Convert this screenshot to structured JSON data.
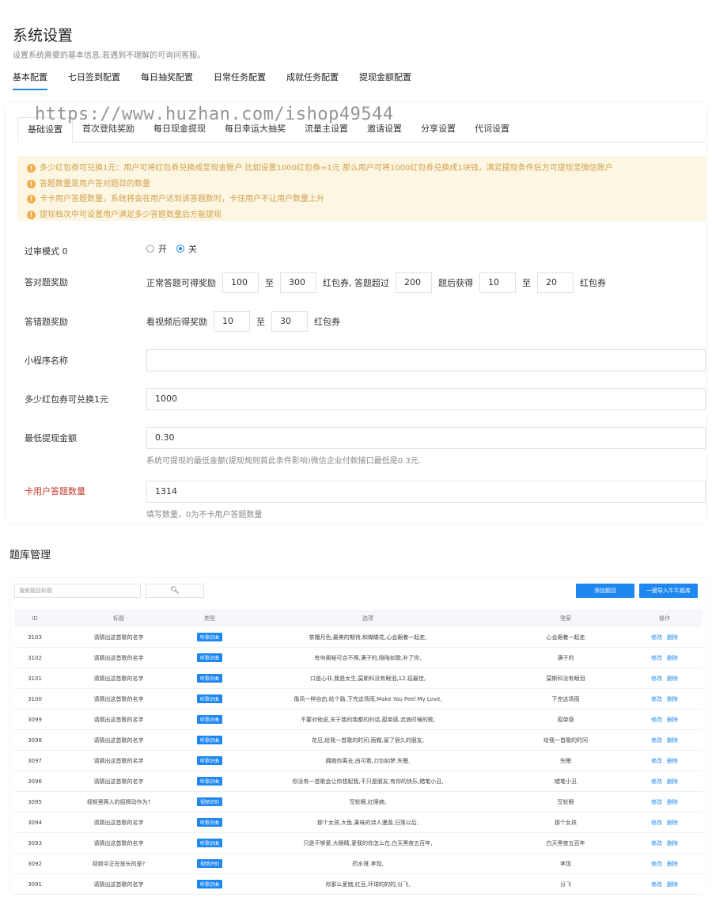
{
  "header": {
    "title": "系统设置",
    "subtitle": "设置系统需要的基本信息,若遇到不理解的可询问客服。"
  },
  "top_tabs": [
    {
      "label": "基本配置",
      "active": true
    },
    {
      "label": "七日签到配置",
      "active": false
    },
    {
      "label": "每日抽奖配置",
      "active": false
    },
    {
      "label": "日常任务配置",
      "active": false
    },
    {
      "label": "成就任务配置",
      "active": false
    },
    {
      "label": "提现金额配置",
      "active": false
    }
  ],
  "sub_tabs": [
    {
      "label": "基础设置",
      "active": true
    },
    {
      "label": "首次登陆奖励",
      "active": false
    },
    {
      "label": "每日现金提现",
      "active": false
    },
    {
      "label": "每日幸运大抽奖",
      "active": false
    },
    {
      "label": "流量主设置",
      "active": false
    },
    {
      "label": "邀请设置",
      "active": false
    },
    {
      "label": "分享设置",
      "active": false
    },
    {
      "label": "代词设置",
      "active": false
    }
  ],
  "notices": [
    "多少红包券可兑换1元：用户可将红包券兑换成至现金账户 比如设置1000红包券=1元 那么用户可将1000红包券兑换成1块钱，满足提现条件后方可提现至微信账户",
    "答题数量是用户答对题目的数量",
    "卡卡用户答题数量，系统将会在用户达到该答题数时，卡住用户不让用户数量上升",
    "提现档次中可设置用户满足多少答题数量后方能提现"
  ],
  "form": {
    "audit_mode": {
      "label": "过审模式 0",
      "on_label": "开",
      "off_label": "关",
      "selected": "off"
    },
    "correct_reward": {
      "label": "答对题奖励",
      "prefix": "正常答题可得奖励",
      "min": "100",
      "to1": "至",
      "max": "300",
      "mid": "红包券, 答题超过",
      "threshold": "200",
      "after": "题后获得",
      "min2": "10",
      "to2": "至",
      "max2": "20",
      "suffix": "红包券"
    },
    "wrong_reward": {
      "label": "答错题奖励",
      "prefix": "看视频后得奖励",
      "min": "10",
      "to": "至",
      "max": "30",
      "suffix": "红包券"
    },
    "mini_name": {
      "label": "小程序名称",
      "value": ""
    },
    "exchange_rate": {
      "label": "多少红包券可兑换1元",
      "value": "1000"
    },
    "min_withdraw": {
      "label": "最低提现金额",
      "value": "0.30",
      "hint": "系统可提现的最低金额(提现规则首此条件影响)微信企业付款接口最低是0.3元."
    },
    "stuck_count": {
      "label": "卡用户答题数量",
      "value": "1314",
      "hint": "填写数量，0为不卡用户答题数量"
    }
  },
  "question_bank": {
    "title": "题库管理",
    "search_placeholder": "搜索题目标题",
    "add_button": "添加题目",
    "import_button": "一键导入牛牛题库",
    "columns": {
      "id": "ID",
      "title": "标题",
      "type": "类型",
      "options": "选项",
      "answer": "答案",
      "actions": "操作"
    },
    "edit_label": "修改",
    "delete_label": "删除",
    "rows": [
      {
        "id": "3103",
        "title": "请猜出这首歌的名字",
        "type": "听歌识曲",
        "options": "茶棚月色,最美的期待,和蝴蝶花,心会跟着一起走,",
        "answer": "心会跟着一起走"
      },
      {
        "id": "3102",
        "title": "请猜出这首歌的名字",
        "type": "听歌识曲",
        "options": "有何奥秘可合不得,满子的,陪陪如歌,补了你,",
        "answer": "满子的"
      },
      {
        "id": "3101",
        "title": "请猜出这首歌的名字",
        "type": "听歌识曲",
        "options": "口是心非,我是女生,莫斯科没有眼泪,12.招最佳,",
        "answer": "莫斯科没有眼泪"
      },
      {
        "id": "3100",
        "title": "请猜出这首歌的名字",
        "type": "听歌识曲",
        "options": "像风一样自由,给个路,下完这场雨,Make You Feel My Love,",
        "answer": "下完这场雨"
      },
      {
        "id": "3099",
        "title": "请猜出这首歌的名字",
        "type": "听歌识曲",
        "options": "不要对他说,关于我的我都的的话,孤单感,流浪时候的歌,",
        "answer": "孤单感"
      },
      {
        "id": "3098",
        "title": "请猜出这首歌的名字",
        "type": "听歌识曲",
        "options": "花见,给我一首歌的时间,雨蝶,留了很久的朋友,",
        "answer": "给我一首歌的时间"
      },
      {
        "id": "3097",
        "title": "请猜出这首歌的名字",
        "type": "听歌识曲",
        "options": "拥抱你离去,由可看,刀剑如梦,失眠,",
        "answer": "失眠"
      },
      {
        "id": "3096",
        "title": "请猜出这首歌的名字",
        "type": "听歌识曲",
        "options": "你没有一首歌会让你想起我,不只是朋友,有你的快乐,蜡笔小丑,",
        "answer": "蜡笔小丑"
      },
      {
        "id": "3095",
        "title": "视频里两人的招牌动作为?",
        "type": "视频识别",
        "options": "写轮眼,红眼病,",
        "answer": "写轮眼"
      },
      {
        "id": "3094",
        "title": "请猜出这首歌的名字",
        "type": "听歌识曲",
        "options": "那个女孩,大鱼,果味的诗人漫游,日落以后,",
        "answer": "那个女孩"
      },
      {
        "id": "3093",
        "title": "请猜出这首歌的名字",
        "type": "听歌识曲",
        "options": "只是不够爱,大眼睛,爱我的你怎么在,白天黑夜五百年,",
        "answer": "白天黑夜五百年"
      },
      {
        "id": "3092",
        "title": "视频中正在放长的是?",
        "type": "视频识别",
        "options": "药水哥,李现,",
        "answer": "李现"
      },
      {
        "id": "3091",
        "title": "请猜出这首歌的名字",
        "type": "听歌识曲",
        "options": "你那么爱她,红豆,环球的的的,分飞,",
        "answer": "分飞"
      }
    ]
  },
  "watermark": "https://www.huzhan.com/ishop49544",
  "colors": {
    "accent": "#1e87f0",
    "notice_bg": "#fdf6e3",
    "notice_text": "#d0a14b",
    "warn_label": "#c0392b"
  }
}
